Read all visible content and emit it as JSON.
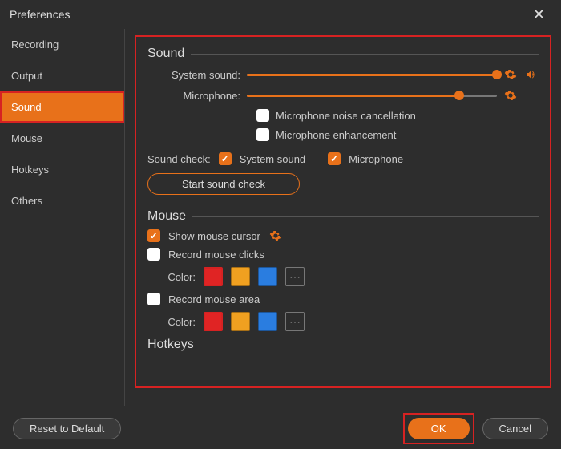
{
  "window": {
    "title": "Preferences"
  },
  "sidebar": {
    "items": [
      {
        "label": "Recording"
      },
      {
        "label": "Output"
      },
      {
        "label": "Sound",
        "active": true
      },
      {
        "label": "Mouse"
      },
      {
        "label": "Hotkeys"
      },
      {
        "label": "Others"
      }
    ]
  },
  "sound": {
    "heading": "Sound",
    "system_label": "System sound:",
    "system_pct": 100,
    "mic_label": "Microphone:",
    "mic_pct": 85,
    "noise_cancel_label": "Microphone noise cancellation",
    "noise_cancel_checked": false,
    "enhance_label": "Microphone enhancement",
    "enhance_checked": false,
    "soundcheck_label": "Sound check:",
    "system_sound_chk_label": "System sound",
    "system_sound_chk": true,
    "mic_chk_label": "Microphone",
    "mic_chk": true,
    "start_btn": "Start sound check"
  },
  "mouse": {
    "heading": "Mouse",
    "show_cursor_label": "Show mouse cursor",
    "show_cursor_checked": true,
    "record_clicks_label": "Record mouse clicks",
    "record_clicks_checked": false,
    "record_area_label": "Record mouse area",
    "record_area_checked": false,
    "color_label": "Color:",
    "colors": {
      "red": "#e02424",
      "yellow": "#f0a020",
      "blue": "#2a7de0"
    }
  },
  "hotkeys": {
    "heading": "Hotkeys"
  },
  "footer": {
    "reset": "Reset to Default",
    "ok": "OK",
    "cancel": "Cancel"
  }
}
